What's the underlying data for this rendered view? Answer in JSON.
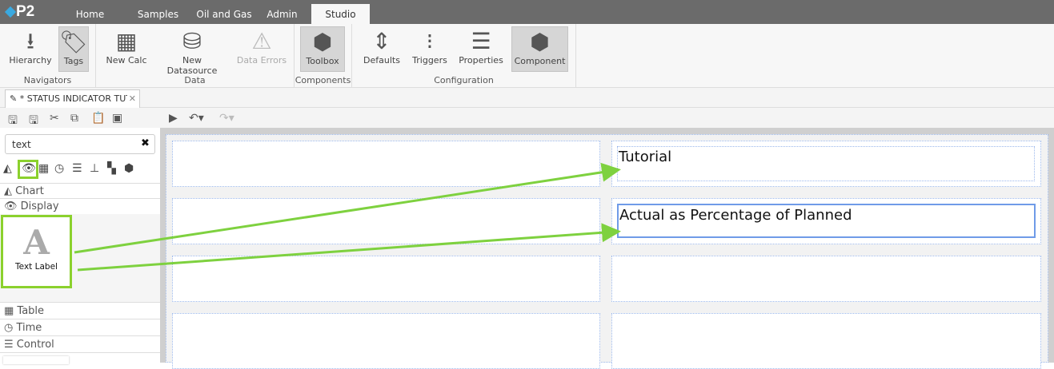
{
  "app": {
    "logo": "P2"
  },
  "nav": {
    "tabs": [
      "Home",
      "Samples",
      "Oil and Gas",
      "Admin",
      "Studio"
    ],
    "active": "Studio"
  },
  "ribbon": {
    "groups": [
      "Navigators",
      "Data",
      "Components",
      "Configuration"
    ],
    "buttons": {
      "hierarchy": "Hierarchy",
      "tags": "Tags",
      "new_calc": "New Calc",
      "new_datasource": "New Datasource",
      "data_errors": "Data Errors",
      "toolbox": "Toolbox",
      "defaults": "Defaults",
      "triggers": "Triggers",
      "properties": "Properties",
      "component": "Component"
    }
  },
  "document_tab": {
    "title": "* STATUS INDICATOR TUT"
  },
  "toolbox": {
    "search_value": "text",
    "sections": {
      "chart": "Chart",
      "display": "Display",
      "table": "Table",
      "time": "Time",
      "control": "Control"
    },
    "items": [
      {
        "label": "Text Label",
        "glyph": "A"
      }
    ]
  },
  "canvas": {
    "labels": {
      "tutorial": "Tutorial",
      "actual": "Actual as Percentage of Planned"
    }
  },
  "colors": {
    "highlight": "#8bd12d",
    "arrow": "#7ed13f",
    "selection": "#6f9be8"
  }
}
